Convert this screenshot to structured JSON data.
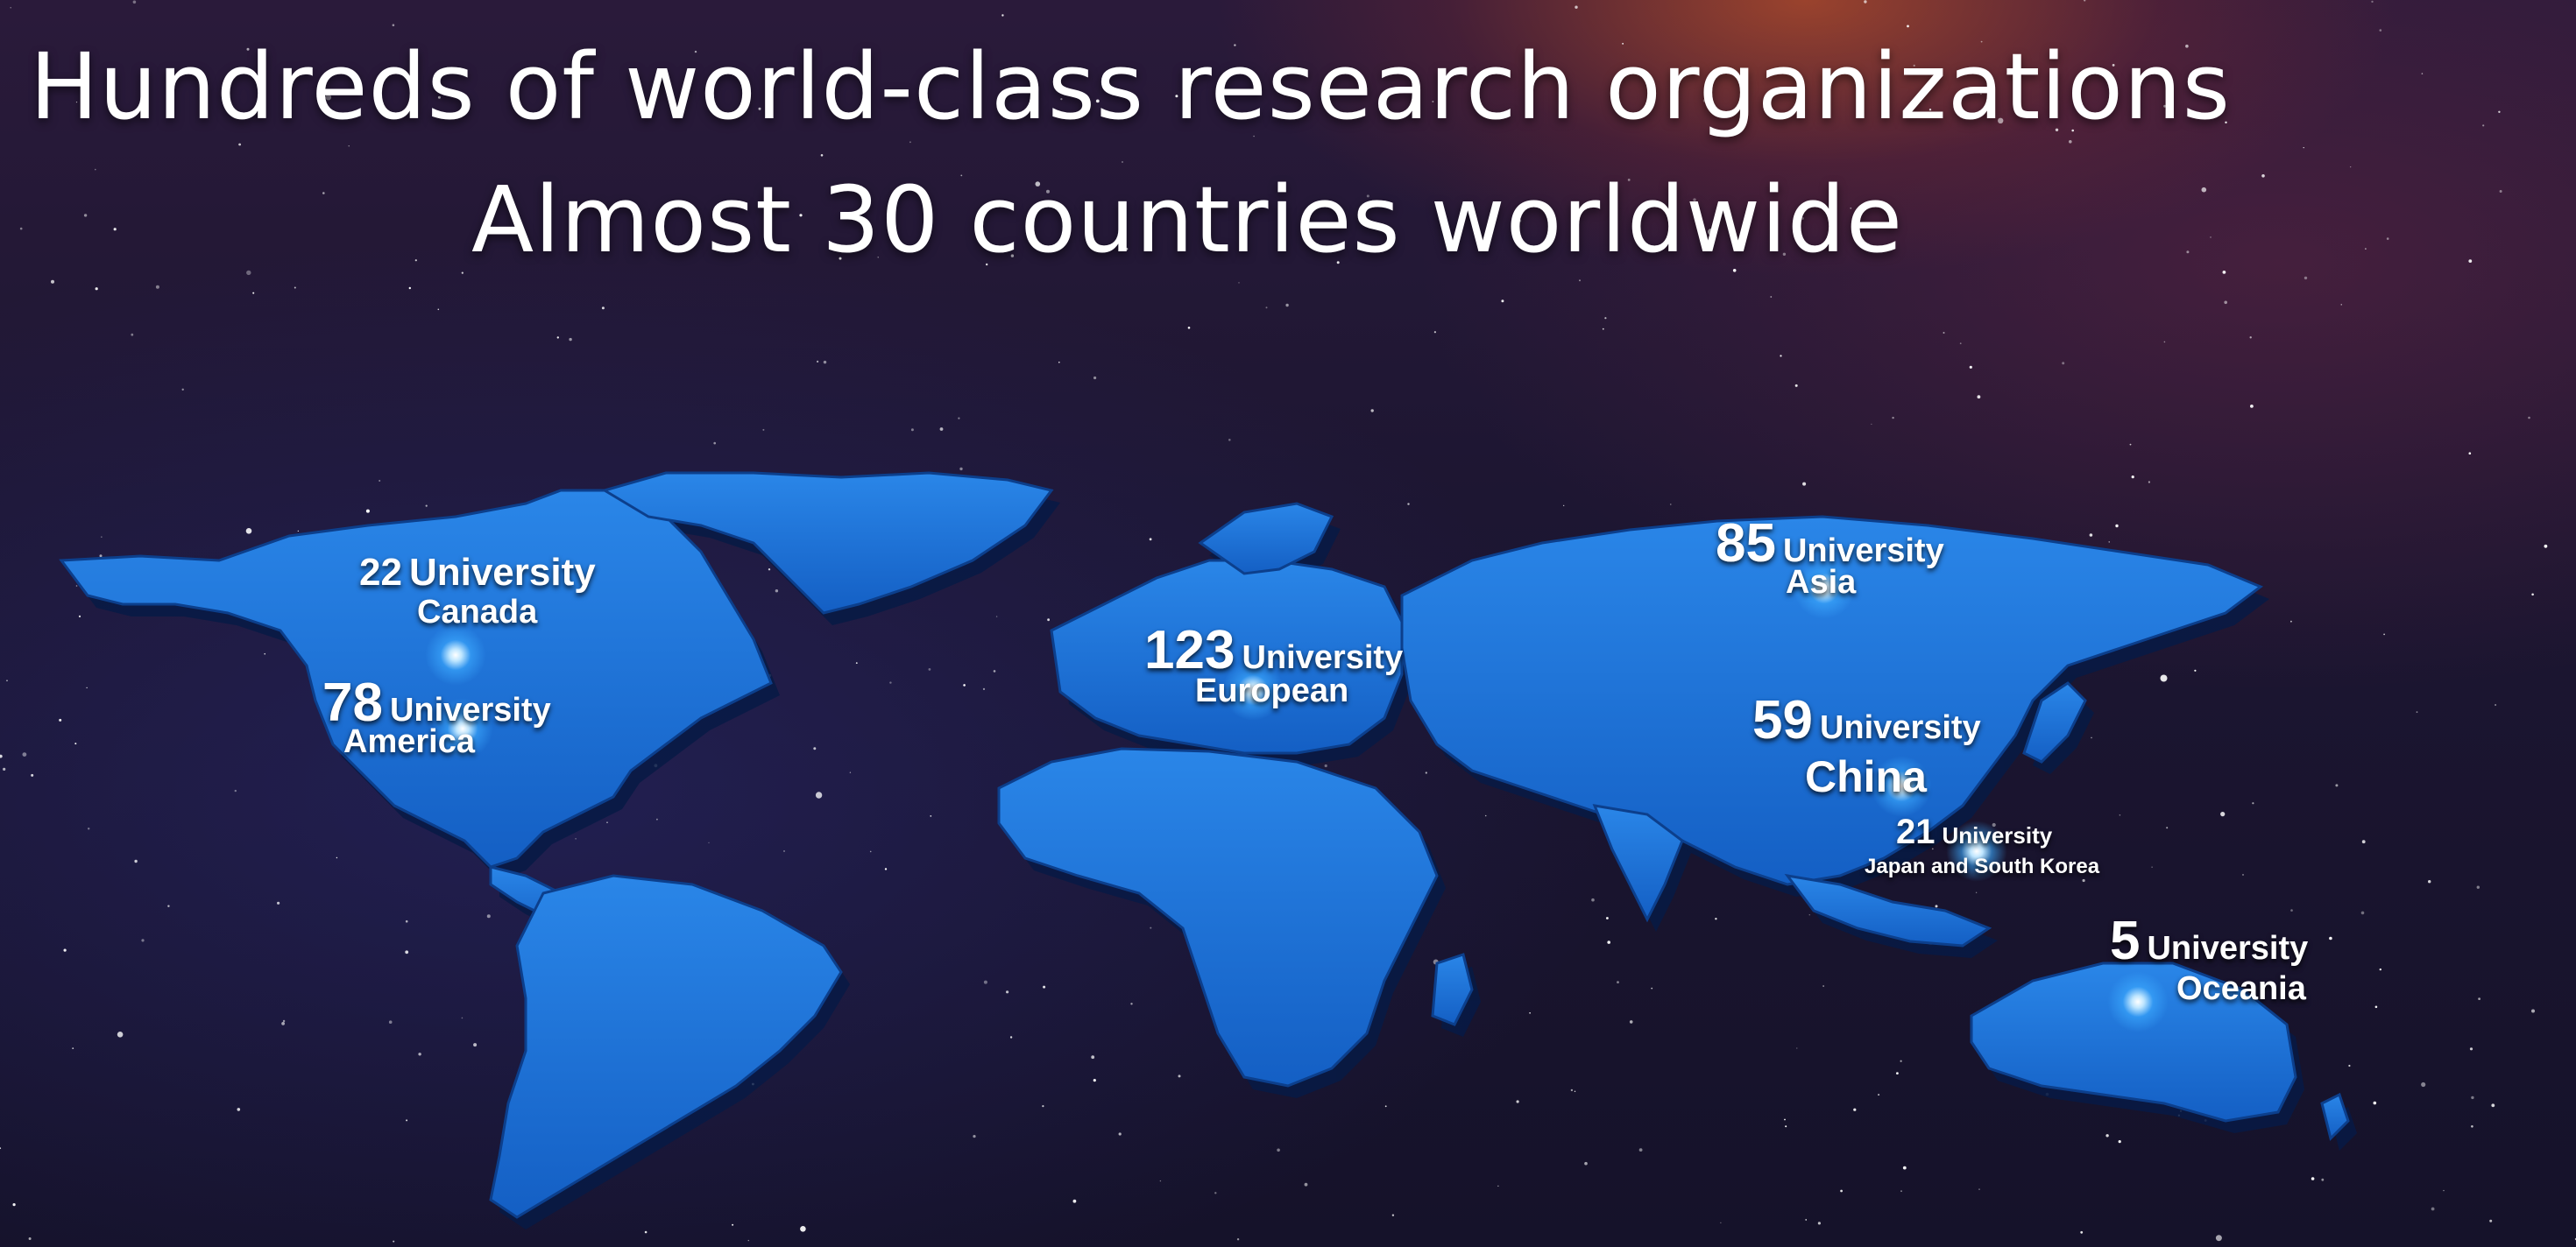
{
  "headline": {
    "line1": "Hundreds of world-class research organizations",
    "line2": "Almost 30 countries worldwide"
  },
  "colors": {
    "land": "#1a73d6",
    "land_edge": "#0b3f8f",
    "background": "#1d1632",
    "glow": "#5fc0ff"
  },
  "regions": [
    {
      "key": "canada",
      "count": "22",
      "unit": "University",
      "name": "Canada"
    },
    {
      "key": "america",
      "count": "78",
      "unit": "University",
      "name": "America"
    },
    {
      "key": "europe",
      "count": "123",
      "unit": "University",
      "name": "European"
    },
    {
      "key": "asia",
      "count": "85",
      "unit": "University",
      "name": "Asia"
    },
    {
      "key": "china",
      "count": "59",
      "unit": "University",
      "name": "China"
    },
    {
      "key": "japan-korea",
      "count": "21",
      "unit": "University",
      "name": "Japan and South Korea"
    },
    {
      "key": "oceania",
      "count": "5",
      "unit": "University",
      "name": "Oceania"
    }
  ]
}
